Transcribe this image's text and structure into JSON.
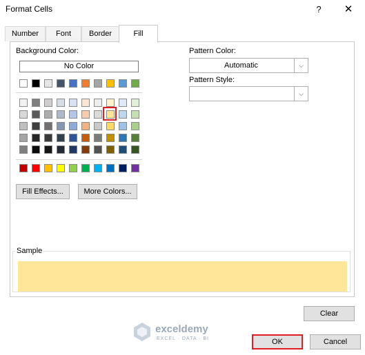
{
  "window": {
    "title": "Format Cells",
    "help_glyph": "?",
    "close_glyph": "✕"
  },
  "tabs": [
    {
      "label": "Number",
      "active": false
    },
    {
      "label": "Font",
      "active": false
    },
    {
      "label": "Border",
      "active": false
    },
    {
      "label": "Fill",
      "active": true
    }
  ],
  "fill": {
    "background_color_label": "Background Color:",
    "no_color_label": "No Color",
    "theme_top_row": [
      "#ffffff",
      "#000000",
      "#e7e6e6",
      "#44546a",
      "#4472c4",
      "#ed7d31",
      "#a5a5a5",
      "#ffc000",
      "#5b9bd5",
      "#70ad47"
    ],
    "theme_shades": [
      [
        "#f2f2f2",
        "#7f7f7f",
        "#d0cece",
        "#d6dce4",
        "#d9e2f3",
        "#fbe5d5",
        "#ededed",
        "#fff2cc",
        "#deeaf6",
        "#e2efd9"
      ],
      [
        "#d8d8d8",
        "#595959",
        "#aeabab",
        "#adb9ca",
        "#b4c6e7",
        "#f7cbac",
        "#dbdbdb",
        "#ffe599",
        "#bdd7ee",
        "#c5e0b3"
      ],
      [
        "#bfbfbf",
        "#3f3f3f",
        "#757070",
        "#8496b0",
        "#8eaadb",
        "#f4b183",
        "#c9c9c9",
        "#ffd966",
        "#9cc3e5",
        "#a8d08d"
      ],
      [
        "#a5a5a5",
        "#262626",
        "#3a3838",
        "#323f4f",
        "#2f5496",
        "#c55a11",
        "#7b7b7b",
        "#bf8f00",
        "#2e75b5",
        "#538135"
      ],
      [
        "#7f7f7f",
        "#0c0c0c",
        "#171616",
        "#222a35",
        "#1f3864",
        "#833c0b",
        "#525252",
        "#7f6000",
        "#1e4e79",
        "#375623"
      ]
    ],
    "standard_colors": [
      "#c00000",
      "#ff0000",
      "#ffc000",
      "#ffff00",
      "#92d050",
      "#00b050",
      "#00b0f0",
      "#0070c0",
      "#002060",
      "#7030a0"
    ],
    "fill_effects_label": "Fill Effects...",
    "more_colors_label": "More Colors...",
    "pattern_color_label": "Pattern Color:",
    "pattern_color_value": "Automatic",
    "pattern_style_label": "Pattern Style:",
    "pattern_style_value": "",
    "sample_label": "Sample",
    "sample_color": "#ffe699",
    "clear_label": "Clear"
  },
  "footer": {
    "ok_label": "OK",
    "cancel_label": "Cancel"
  },
  "watermark": {
    "name": "exceldemy",
    "tagline": "EXCEL · DATA · BI"
  },
  "accent": {
    "highlight_red": "#e31b23"
  }
}
